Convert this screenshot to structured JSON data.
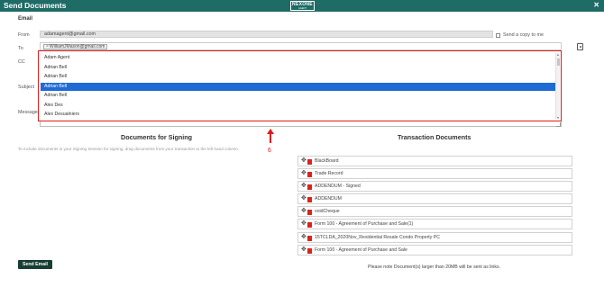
{
  "header": {
    "title": "Send Documents",
    "logo_top": "NEXONE",
    "logo_bottom": "AGENT",
    "close_glyph": "✕"
  },
  "email": {
    "section_title": "Email",
    "from_label": "From",
    "from_value": "adamagent@gmail.com",
    "copy_label": "Send a copy to me",
    "copy_checked": false,
    "to_label": "To",
    "to_chip": "WilliamJMason@gmail.com",
    "cc_label": "CC",
    "subject_label": "Subject",
    "message_label": "Message",
    "contacts_icon": "address-book-icon"
  },
  "dropdown": {
    "items": [
      "Adam Agent",
      "Adrian Bell",
      "Adrian Bell",
      "Adrian Bell",
      "Adrian Bell",
      "Alex Des",
      "Alex Desualniers"
    ],
    "selected_index": 3,
    "highlight_color": "#e01b1b",
    "selected_color": "#1e6bd6"
  },
  "annotation": {
    "number": "6",
    "color": "#e01b1b"
  },
  "signing": {
    "title": "Documents for Signing",
    "hint": "To include documents in your Signing Session for signing, drag documents from your transaction to the left hand column."
  },
  "transaction": {
    "title": "Transaction Documents",
    "documents": [
      "BlackBoard",
      "Trade Record",
      "ADDENDUM - Signed",
      "ADDENDUM",
      "voidCheque",
      "Form 100 - Agreement of Purchase and Sale(1)",
      "15TCLDA_2020Nov_Residential Resale Condo Property PC",
      "Form 100 - Agreement of Purchase and Sale"
    ]
  },
  "footer": {
    "send_label": "Send Email",
    "note": "Please note Document(s) larger than 20MB will be sent as links."
  },
  "colors": {
    "header": "#1f6b66",
    "send_button": "#183d33",
    "pdf_icon": "#d9231d"
  }
}
